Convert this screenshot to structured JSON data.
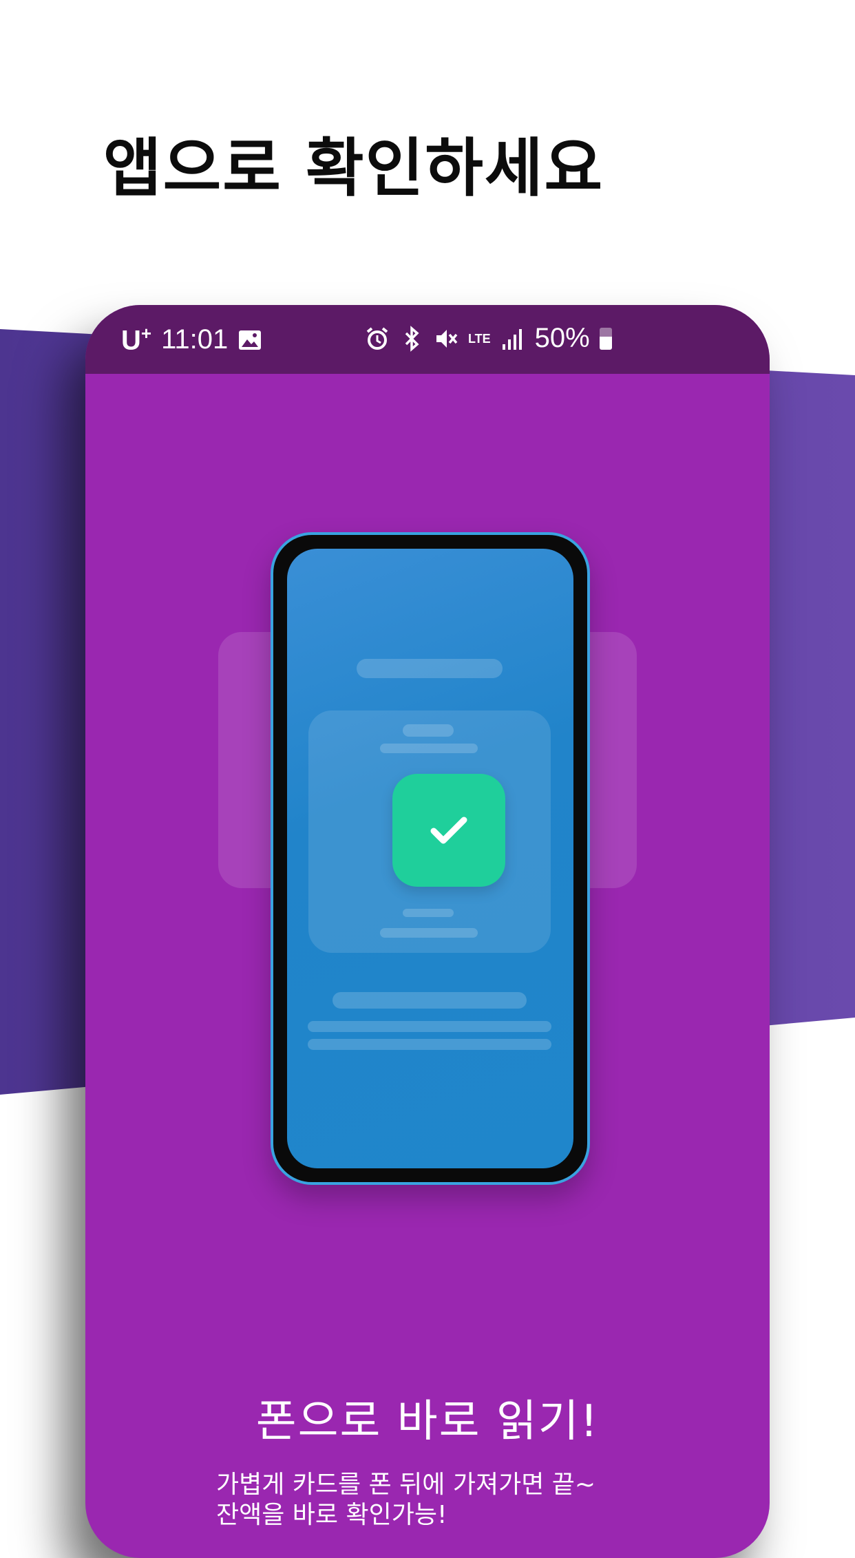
{
  "header": {
    "title": "앱으로 확인하세요"
  },
  "statusbar": {
    "carrier": "U",
    "carrier_sup": "+",
    "time": "11:01",
    "network": "LTE",
    "battery": "50%",
    "icons": [
      "image-icon",
      "alarm-icon",
      "bluetooth-icon",
      "mute-icon",
      "lte-icon",
      "signal-icon",
      "battery-icon"
    ]
  },
  "feature": {
    "title": "폰으로 바로 읽기!",
    "description": "가볍게 카드를 폰 뒤에 가져가면 끝~\n잔액을 바로 확인가능!"
  },
  "colors": {
    "screen_bg": "#9a27b0",
    "statusbar_bg": "#5c1a66",
    "phone_screen": "#2184ca",
    "check_green": "#1fcf9b",
    "band": "#5b3a9e"
  }
}
